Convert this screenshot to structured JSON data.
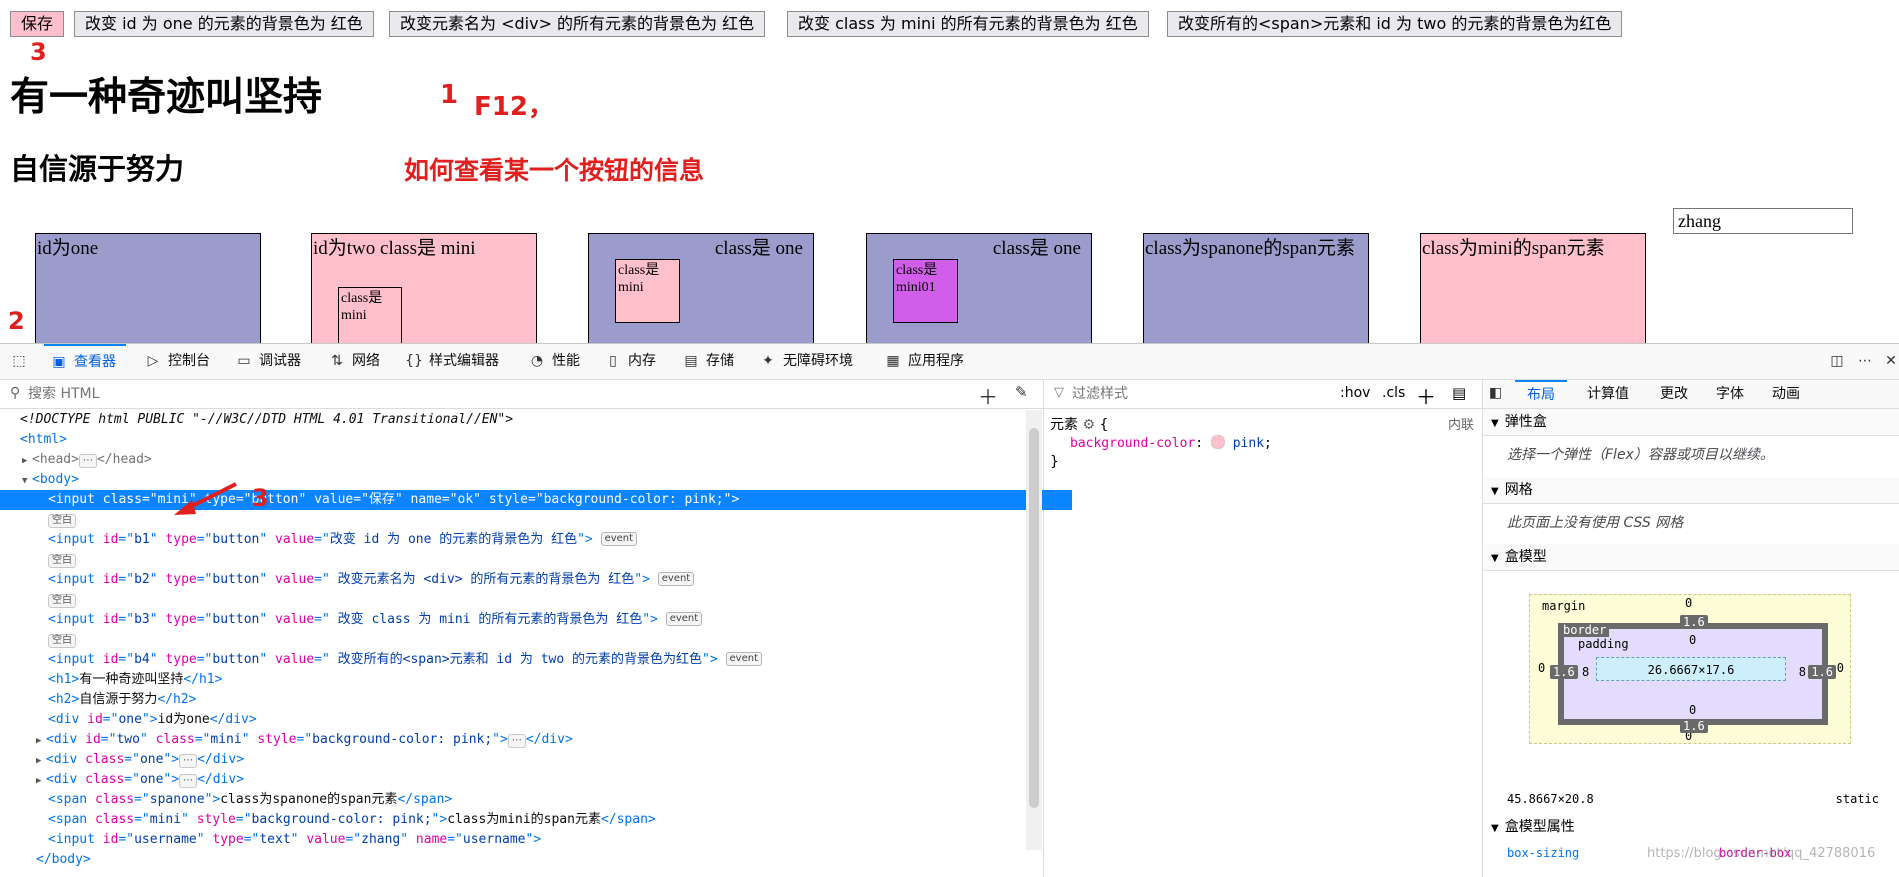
{
  "page": {
    "buttons": [
      {
        "label": "保存"
      },
      {
        "label": "改变 id 为 one 的元素的背景色为 红色"
      },
      {
        "label": "改变元素名为 <div> 的所有元素的背景色为 红色"
      },
      {
        "label": "改变 class 为 mini 的所有元素的背景色为 红色"
      },
      {
        "label": "改变所有的<span>元素和 id 为 two 的元素的背景色为红色"
      }
    ],
    "h1": "有一种奇迹叫坚持",
    "h2": "自信源于努力",
    "annotations": {
      "n3_top": "3",
      "n1": "1",
      "f12": "F12，",
      "question": "如何查看某一个按钮的信息",
      "n2": "2",
      "n3_tree": "3"
    },
    "boxes": {
      "one": "id为one",
      "two": "id为two class是 mini",
      "two_inner": "class是 mini",
      "one_a": "class是 one",
      "one_a_inner": "class是 mini",
      "one_b": "class是 one",
      "one_b_inner": "class是 mini01",
      "spanone": "class为spanone的span元素",
      "spanmini": "class为mini的span元素"
    },
    "username_value": "zhang"
  },
  "devtools": {
    "tabs": [
      {
        "label": "查看器",
        "icon": "inspector-icon"
      },
      {
        "label": "控制台",
        "icon": "console-icon"
      },
      {
        "label": "调试器",
        "icon": "debugger-icon"
      },
      {
        "label": "网络",
        "icon": "network-icon"
      },
      {
        "label": "样式编辑器",
        "icon": "style-editor-icon"
      },
      {
        "label": "性能",
        "icon": "performance-icon"
      },
      {
        "label": "内存",
        "icon": "memory-icon"
      },
      {
        "label": "存储",
        "icon": "storage-icon"
      },
      {
        "label": "无障碍环境",
        "icon": "accessibility-icon"
      },
      {
        "label": "应用程序",
        "icon": "application-icon"
      }
    ],
    "search_placeholder": "搜索 HTML",
    "tree": {
      "doctype": "<!DOCTYPE html PUBLIC \"-//W3C//DTD HTML 4.01 Transitional//EN\">",
      "html_open": "<html>",
      "head": "<head>",
      "head_close": "</head>",
      "body_open": "<body>",
      "whitespace_badge": "空白",
      "event_badge": "event",
      "sel_input": "<input class=\"mini\" type=\"button\" value=\"保存\" name=\"ok\" style=\"background-color: pink;\">",
      "b1": {
        "id": "b1",
        "value": "改变 id 为 one 的元素的背景色为 红色"
      },
      "b2": {
        "id": "b2",
        "value": " 改变元素名为 <div> 的所有元素的背景色为 红色"
      },
      "b3": {
        "id": "b3",
        "value": " 改变 class 为 mini 的所有元素的背景色为 红色"
      },
      "b4": {
        "id": "b4",
        "value": " 改变所有的<span>元素和 id 为 two 的元素的背景色为红色"
      },
      "h1_text": "有一种奇迹叫坚持",
      "h2_text": "自信源于努力",
      "div_one_text": "id为one",
      "span1_text": "class为spanone的span元素",
      "span2_text": "class为mini的span元素",
      "body_close": "</body>"
    },
    "rules": {
      "filter_placeholder": "过滤样式",
      "hov": ":hov",
      "cls": ".cls",
      "selector": "元素",
      "origin": "内联",
      "prop": "background-color",
      "value": "pink",
      "open_brace": "{",
      "close_brace": "}"
    },
    "layout": {
      "tabs": [
        "布局",
        "计算值",
        "更改",
        "字体",
        "动画"
      ],
      "flex_title": "弹性盒",
      "flex_body": "选择一个弹性（Flex）容器或项目以继续。",
      "grid_title": "网格",
      "grid_body": "此页面上没有使用 CSS 网格",
      "boxmodel_title": "盒模型",
      "margin_label": "margin",
      "border_label": "border",
      "padding_label": "padding",
      "margin_top": "0",
      "margin_bottom": "0",
      "margin_left": "0",
      "margin_right": "0",
      "border_top": "1.6",
      "border_bottom": "1.6",
      "border_left": "1.6",
      "border_right": "1.6",
      "padding_top": "0",
      "padding_bottom": "0",
      "padding_left": "8",
      "padding_right": "8",
      "content": "26.6667×17.6",
      "size": "45.8667×20.8",
      "position": "static",
      "props_title": "盒模型属性",
      "prop_name": "box-sizing",
      "prop_value": "border-box",
      "watermark": "https://blog.csdn.net/qq_42788016"
    }
  }
}
